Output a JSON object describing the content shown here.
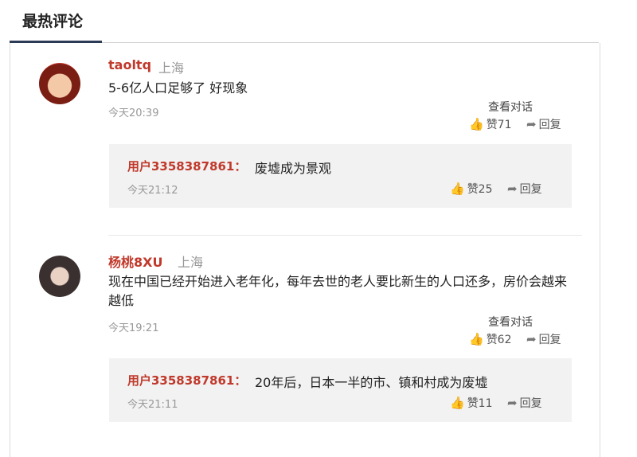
{
  "header": {
    "title": "最热评论"
  },
  "comments": [
    {
      "username": "taoltq",
      "location": "上海",
      "text": "5-6亿人口足够了 好现象",
      "time": "今天20:39",
      "view_conversation": "查看对话",
      "likes": "赞71",
      "reply_label": "回复",
      "reply": {
        "username": "用户3358387861：",
        "text": "废墟成为景观",
        "time": "今天21:12",
        "likes": "赞25",
        "reply_label": "回复"
      }
    },
    {
      "username": "杨桃8XU",
      "location": "上海",
      "text": "现在中国已经开始进入老年化，每年去世的老人要比新生的人口还多，房价会越来越低",
      "time": "今天19:21",
      "view_conversation": "查看对话",
      "likes": "赞62",
      "reply_label": "回复",
      "reply": {
        "username": "用户3358387861：",
        "text": "20年后，日本一半的市、镇和村成为废墟",
        "time": "今天21:11",
        "likes": "赞11",
        "reply_label": "回复"
      }
    }
  ]
}
